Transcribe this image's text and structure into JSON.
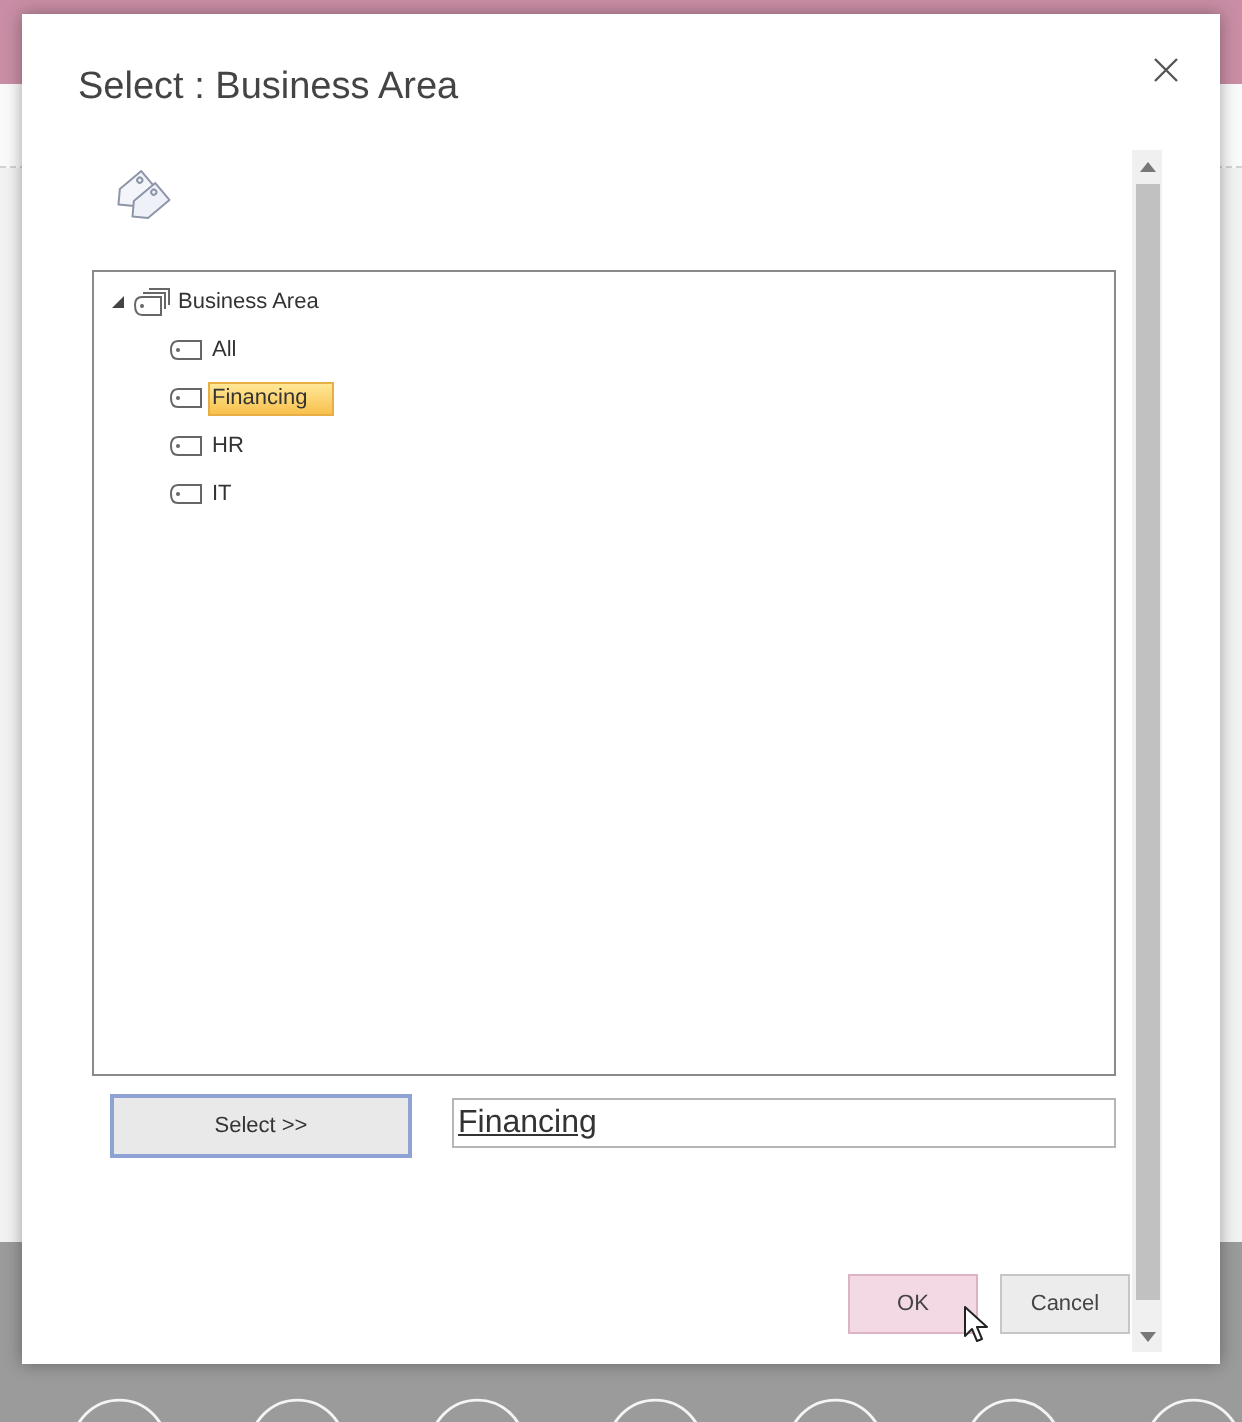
{
  "dialog": {
    "title": "Select : Business Area"
  },
  "tree": {
    "label": "Business Area",
    "expanded": true,
    "children": [
      {
        "label": "All",
        "selected": false
      },
      {
        "label": "Financing",
        "selected": true
      },
      {
        "label": "HR",
        "selected": false
      },
      {
        "label": "IT",
        "selected": false
      }
    ]
  },
  "select_button": {
    "label": "Select >>",
    "focused": true
  },
  "selection_field": {
    "value": "Financing"
  },
  "buttons": [
    {
      "label": "OK",
      "hovered": true
    },
    {
      "label": "Cancel",
      "hovered": false
    }
  ]
}
